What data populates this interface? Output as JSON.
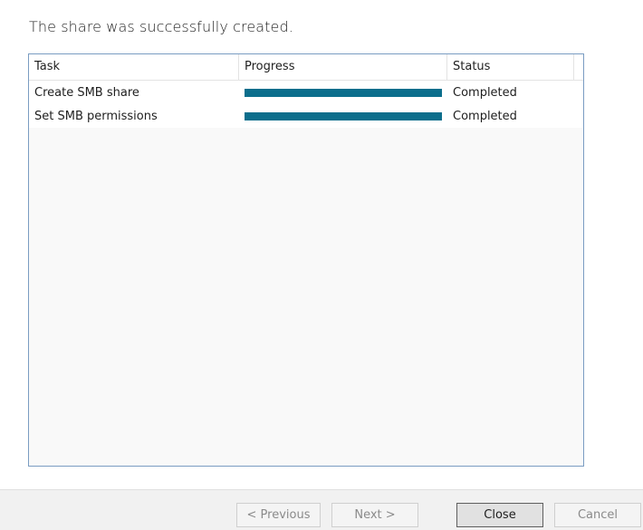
{
  "message": "The share was successfully created.",
  "table": {
    "columns": {
      "task": "Task",
      "progress": "Progress",
      "status": "Status"
    },
    "rows": [
      {
        "task": "Create SMB share",
        "progress": 1.0,
        "status": "Completed"
      },
      {
        "task": "Set SMB permissions",
        "progress": 1.0,
        "status": "Completed"
      }
    ]
  },
  "buttons": {
    "previous": "< Previous",
    "next": "Next >",
    "close": "Close",
    "cancel": "Cancel"
  },
  "colors": {
    "progress_fill": "#0b6e8c",
    "border_accent": "#7a9cc2"
  }
}
